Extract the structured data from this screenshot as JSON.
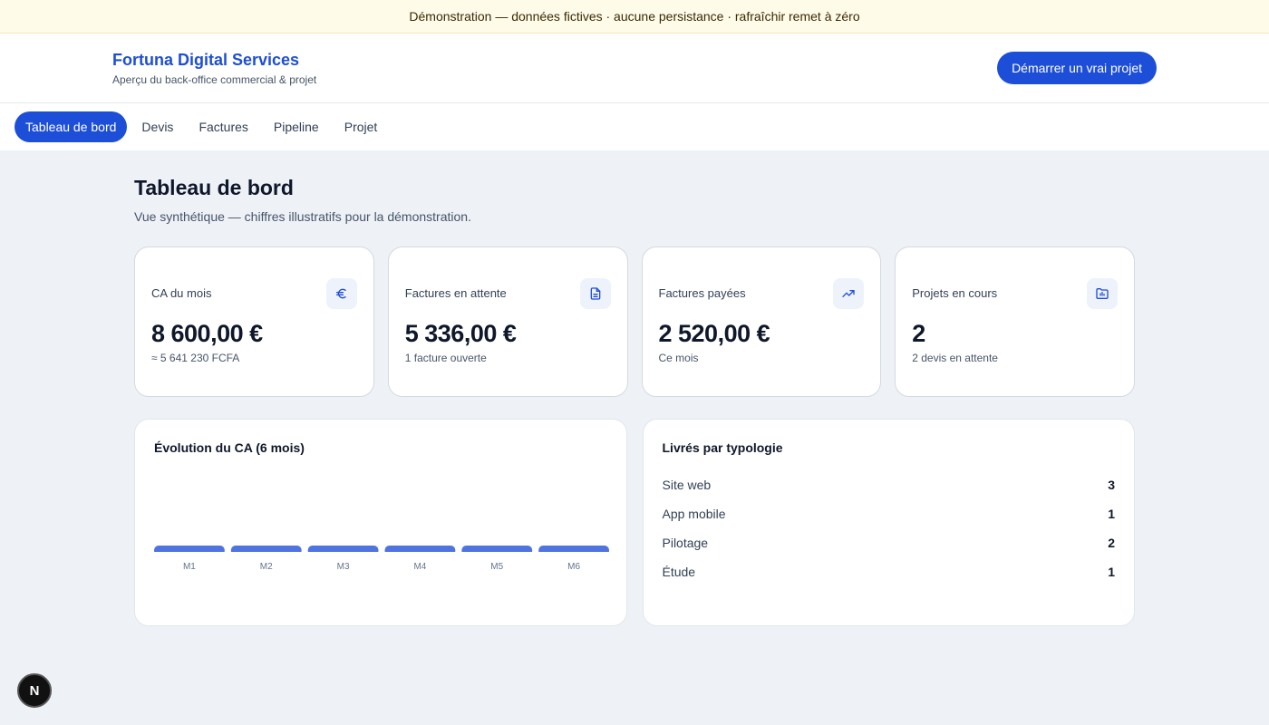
{
  "banner": {
    "text": "Démonstration — données fictives · aucune persistance · rafraîchir remet à zéro"
  },
  "header": {
    "title": "Fortuna Digital Services",
    "subtitle": "Aperçu du back-office commercial & projet",
    "cta_label": "Démarrer un vrai projet"
  },
  "nav": {
    "items": [
      {
        "label": "Tableau de bord",
        "active": true
      },
      {
        "label": "Devis",
        "active": false
      },
      {
        "label": "Factures",
        "active": false
      },
      {
        "label": "Pipeline",
        "active": false
      },
      {
        "label": "Projet",
        "active": false
      }
    ]
  },
  "page": {
    "title": "Tableau de bord",
    "subtitle": "Vue synthétique — chiffres illustratifs pour la démonstration."
  },
  "kpis": [
    {
      "label": "CA du mois",
      "value": "8 600,00 €",
      "note": "≈ 5 641 230 FCFA",
      "icon": "euro-icon"
    },
    {
      "label": "Factures en attente",
      "value": "5 336,00 €",
      "note": "1 facture ouverte",
      "icon": "document-icon"
    },
    {
      "label": "Factures payées",
      "value": "2 520,00 €",
      "note": "Ce mois",
      "icon": "trending-up-icon"
    },
    {
      "label": "Projets en cours",
      "value": "2",
      "note": "2 devis en attente",
      "icon": "folder-chart-icon"
    }
  ],
  "revenue_panel": {
    "title": "Évolution du CA (6 mois)"
  },
  "chart_data": {
    "type": "bar",
    "title": "Évolution du CA (6 mois)",
    "categories": [
      "M1",
      "M2",
      "M3",
      "M4",
      "M5",
      "M6"
    ],
    "values": [
      0,
      0,
      0,
      0,
      0,
      0
    ],
    "xlabel": "",
    "ylabel": "",
    "grid": false,
    "bar_color": "#4f74e0"
  },
  "typology_panel": {
    "title": "Livrés par typologie",
    "items": [
      {
        "label": "Site web",
        "count": "3"
      },
      {
        "label": "App mobile",
        "count": "1"
      },
      {
        "label": "Pilotage",
        "count": "2"
      },
      {
        "label": "Étude",
        "count": "1"
      }
    ]
  },
  "badge": {
    "text": "N"
  },
  "colors": {
    "accent": "#1d4ed8",
    "background": "#eef1f6",
    "banner": "#fefbe8"
  }
}
